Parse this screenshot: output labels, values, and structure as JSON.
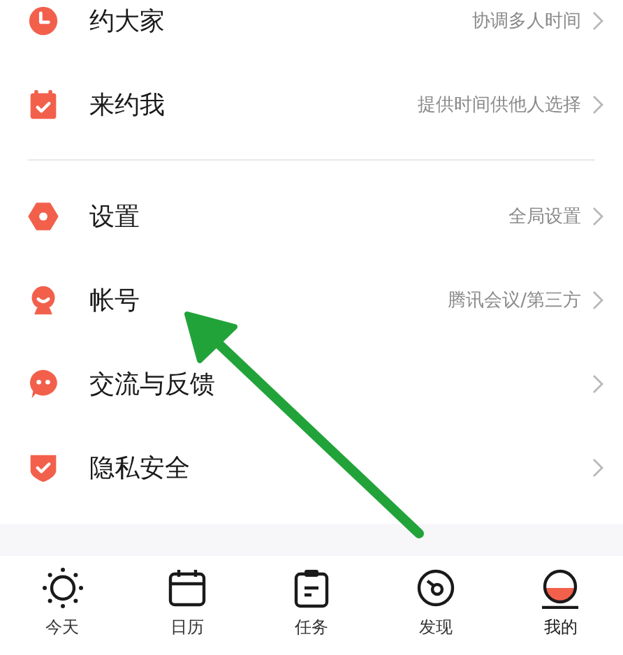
{
  "menu_groups": [
    {
      "items": [
        {
          "kind": "clock",
          "label": "约大家",
          "hint": "协调多人时间"
        },
        {
          "kind": "calendar",
          "label": "来约我",
          "hint": "提供时间供他人选择"
        }
      ]
    },
    {
      "items": [
        {
          "kind": "hexagon",
          "label": "设置",
          "hint": "全局设置"
        },
        {
          "kind": "person",
          "label": "帐号",
          "hint": "腾讯会议/第三方"
        },
        {
          "kind": "chat",
          "label": "交流与反馈"
        },
        {
          "kind": "shield",
          "label": "隐私安全"
        }
      ]
    }
  ],
  "annotation": {
    "kind": "arrow"
  },
  "tab_bar": [
    {
      "kind": "sun",
      "label": "今天",
      "selected": false
    },
    {
      "kind": "calendar",
      "label": "日历",
      "selected": false
    },
    {
      "kind": "clipboard",
      "label": "任务",
      "selected": false
    },
    {
      "kind": "disc",
      "label": "发现",
      "selected": false
    },
    {
      "kind": "me",
      "label": "我的",
      "selected": true
    }
  ]
}
